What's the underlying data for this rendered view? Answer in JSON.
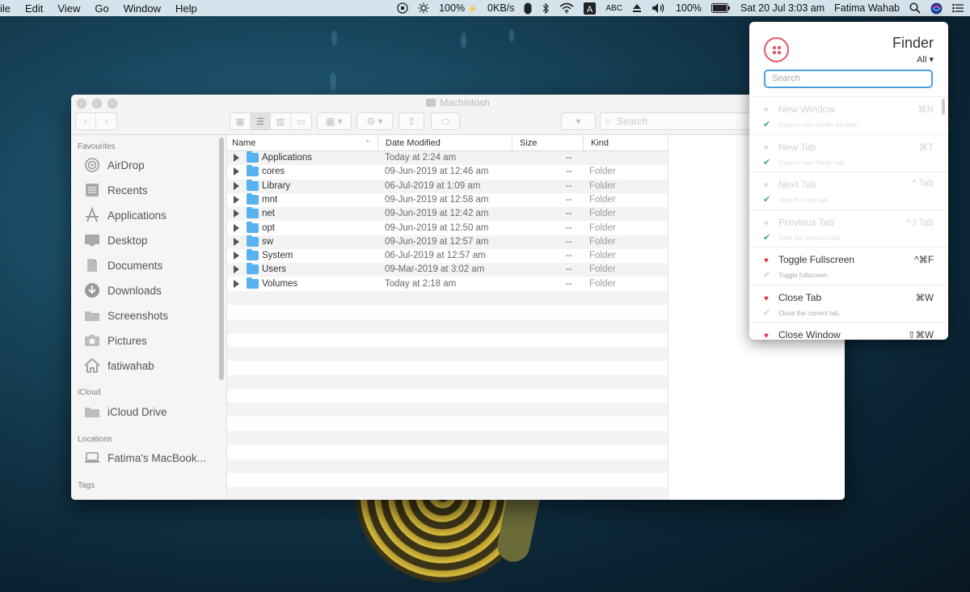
{
  "menubar": {
    "menus": [
      "ile",
      "Edit",
      "View",
      "Go",
      "Window",
      "Help"
    ],
    "battery_pct_a": "100%",
    "network_speed": "0KB/s",
    "input_label": "ABC",
    "volume_pct": "100%",
    "datetime": "Sat 20 Jul  3:03 am",
    "user": "Fatima Wahab"
  },
  "window": {
    "title": "Machintosh",
    "search_placeholder": "Search"
  },
  "sidebar": {
    "sections": {
      "favourites": "Favourites",
      "icloud": "iCloud",
      "locations": "Locations",
      "tags": "Tags"
    },
    "favourites": [
      {
        "label": "AirDrop",
        "icon": "airdrop-icon"
      },
      {
        "label": "Recents",
        "icon": "recents-icon"
      },
      {
        "label": "Applications",
        "icon": "applications-icon"
      },
      {
        "label": "Desktop",
        "icon": "desktop-icon"
      },
      {
        "label": "Documents",
        "icon": "documents-icon"
      },
      {
        "label": "Downloads",
        "icon": "downloads-icon"
      },
      {
        "label": "Screenshots",
        "icon": "folder-icon"
      },
      {
        "label": "Pictures",
        "icon": "camera-icon"
      },
      {
        "label": "fatiwahab",
        "icon": "home-icon"
      }
    ],
    "icloud": [
      {
        "label": "iCloud Drive",
        "icon": "folder-icon"
      }
    ],
    "locations": [
      {
        "label": "Fatima's MacBook...",
        "icon": "laptop-icon"
      }
    ]
  },
  "columns": {
    "name": "Name",
    "date": "Date Modified",
    "size": "Size",
    "kind": "Kind"
  },
  "files": [
    {
      "name": "Applications",
      "date": "Today at 2:24 am",
      "size": "--",
      "kind": ""
    },
    {
      "name": "cores",
      "date": "09-Jun-2019 at 12:46 am",
      "size": "--",
      "kind": "Folder"
    },
    {
      "name": "Library",
      "date": "06-Jul-2019 at 1:09 am",
      "size": "--",
      "kind": "Folder"
    },
    {
      "name": "mnt",
      "date": "09-Jun-2019 at 12:58 am",
      "size": "--",
      "kind": "Folder"
    },
    {
      "name": "net",
      "date": "09-Jun-2019 at 12:42 am",
      "size": "--",
      "kind": "Folder"
    },
    {
      "name": "opt",
      "date": "09-Jun-2019 at 12:50 am",
      "size": "--",
      "kind": "Folder"
    },
    {
      "name": "sw",
      "date": "09-Jun-2019 at 12:57 am",
      "size": "--",
      "kind": "Folder"
    },
    {
      "name": "System",
      "date": "06-Jul-2019 at 12:57 am",
      "size": "--",
      "kind": "Folder"
    },
    {
      "name": "Users",
      "date": "09-Mar-2019 at 3:02 am",
      "size": "--",
      "kind": "Folder"
    },
    {
      "name": "Volumes",
      "date": "Today at 2:18 am",
      "size": "--",
      "kind": "Folder"
    }
  ],
  "popup": {
    "title": "Finder",
    "filter": "All",
    "search_placeholder": "Search",
    "commands": [
      {
        "name": "New Window",
        "shortcut": "⌘N",
        "desc": "Open a new Finder window."
      },
      {
        "name": "New Tab",
        "shortcut": "⌘T",
        "desc": "Open a new Finder tab."
      },
      {
        "name": "Next Tab",
        "shortcut": "^ Tab",
        "desc": "View the next tab."
      },
      {
        "name": "Previous Tab",
        "shortcut": "^⇧Tab",
        "desc": "View the previous tab."
      },
      {
        "name": "Toggle Fullscreen",
        "shortcut": "^⌘F",
        "desc": "Toggle fullscreen."
      },
      {
        "name": "Close Tab",
        "shortcut": "⌘W",
        "desc": "Close the current tab."
      },
      {
        "name": "Close Window",
        "shortcut": "⇧⌘W",
        "desc": ""
      }
    ]
  },
  "colors": {
    "accent": "#4a9fe0",
    "heart": "#e03346",
    "check": "#3da864",
    "folder": "#56b3f0"
  }
}
